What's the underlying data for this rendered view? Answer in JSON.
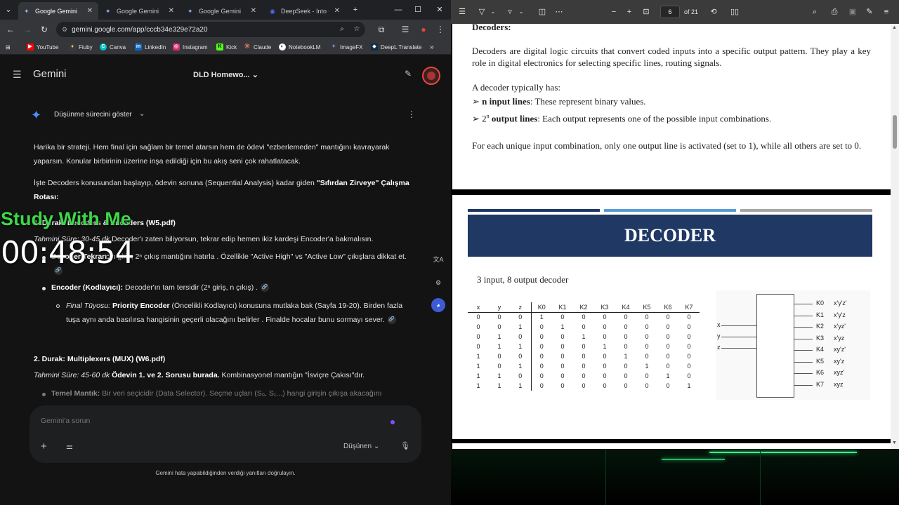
{
  "browser": {
    "tabs": [
      {
        "label": "Google Gemini",
        "active": true
      },
      {
        "label": "Google Gemini",
        "active": false
      },
      {
        "label": "Google Gemini",
        "active": false
      },
      {
        "label": "DeepSeek - Into the",
        "active": false
      }
    ],
    "url": "gemini.google.com/app/cccb34e329e72a20",
    "bookmarks": [
      "YouTube",
      "Fiuby",
      "Canva",
      "LinkedIn",
      "Instagram",
      "Kick",
      "Claude",
      "NotebookLM",
      "ImageFX",
      "DeepL Translate"
    ]
  },
  "gemini": {
    "app_title": "Gemini",
    "chat_title": "DLD Homewo...",
    "show_thinking": "Düşünme sürecini göster",
    "intro": "Harika bir strateji. Hem final için sağlam bir temel atarsın hem de ödevi \"ezberlemeden\" mantığını kavrayarak yaparsın. Konular birbirinin üzerine inşa edildiği için bu akış seni çok rahatlatacak.",
    "route_prefix": "İşte Decoders konusundan başlayıp, ödevin sonuna (Sequential Analysis) kadar giden ",
    "route_bold": "\"Sıfırdan Zirveye\" Çalışma Rotası",
    "route_suffix": ":",
    "step1_title": "1. Durak: Decoders & Encoders (W5.pdf)",
    "step1_time": "Tahmini Süre: 30-45 dk",
    "step1_time_rest": " Decoder'ı zaten biliyorsun, tekrar edip hemen ikiz kardeşi Encoder'a bakmalısın.",
    "step1_b1_bold": "Decoder Tekrarı:",
    "step1_b1_text": " n giriş, 2ⁿ çıkış mantığını hatırla . Özellikle \"Active High\" vs \"Active Low\" çıkışlara dikkat et.",
    "step1_b2_bold": "Encoder (Kodlayıcı):",
    "step1_b2_text": " Decoder'ın tam tersidir (2ⁿ giriş, n çıkış) .",
    "step1_tip_label": "Final Tüyosu:",
    "step1_tip_bold": " Priority Encoder",
    "step1_tip_text": " (Öncelikli Kodlayıcı) konusuna mutlaka bak (Sayfa 19-20). Birden fazla tuşa aynı anda basılırsa hangisinin geçerli olacağını belirler . Finalde hocalar bunu sormayı sever.",
    "step2_title": "2. Durak: Multiplexers (MUX) (W6.pdf)",
    "step2_time": "Tahmini Süre: 45-60 dk",
    "step2_bold": " Ödevin 1. ve 2. Sorusu burada.",
    "step2_text": " Kombinasyonel mantığın \"İsviçre Çakısı\"dır.",
    "step2_b1_bold": "Temel Mantık:",
    "step2_b1_text": " Bir veri seçicidir (Data Selector). Seçme uçları (S₀, S₁...) hangi girişin çıkışa akacağını",
    "prompt_placeholder": "Gemini'a sorun",
    "mode_label": "Düşünen",
    "disclaimer": "Gemini hata yapabildiğinden verdiği yanıtları doğrulayın."
  },
  "overlay": {
    "study_label": "Study With Me",
    "timer": "00:48:54"
  },
  "pdf": {
    "page_number": "6",
    "page_total": "of 21",
    "decoders_heading": "Decoders:",
    "decoders_p1": "Decoders are digital logic circuits that convert coded inputs into a specific output pattern. They play a key role in digital electronics for selecting specific lines, routing signals.",
    "decoders_p2": "A decoder typically has:",
    "item1_bold": "n input lines",
    "item1_text": ": These represent binary values.",
    "item2_pre": "2",
    "item2_sup": "n",
    "item2_bold": " output lines",
    "item2_text": ": Each output represents one of the possible input combinations.",
    "decoders_p3": "For each unique input combination, only one output line is activated (set to 1), while all others are set to 0.",
    "slide_title": "DECODER",
    "slide_subtitle": "3 input, 8 output decoder",
    "table_headers": [
      "x",
      "y",
      "z",
      "K0",
      "K1",
      "K2",
      "K3",
      "K4",
      "K5",
      "K6",
      "K7"
    ],
    "table_rows": [
      [
        "0",
        "0",
        "0",
        "1",
        "0",
        "0",
        "0",
        "0",
        "0",
        "0",
        "0"
      ],
      [
        "0",
        "0",
        "1",
        "0",
        "1",
        "0",
        "0",
        "0",
        "0",
        "0",
        "0"
      ],
      [
        "0",
        "1",
        "0",
        "0",
        "0",
        "1",
        "0",
        "0",
        "0",
        "0",
        "0"
      ],
      [
        "0",
        "1",
        "1",
        "0",
        "0",
        "0",
        "1",
        "0",
        "0",
        "0",
        "0"
      ],
      [
        "1",
        "0",
        "0",
        "0",
        "0",
        "0",
        "0",
        "1",
        "0",
        "0",
        "0"
      ],
      [
        "1",
        "0",
        "1",
        "0",
        "0",
        "0",
        "0",
        "0",
        "1",
        "0",
        "0"
      ],
      [
        "1",
        "1",
        "0",
        "0",
        "0",
        "0",
        "0",
        "0",
        "0",
        "1",
        "0"
      ],
      [
        "1",
        "1",
        "1",
        "0",
        "0",
        "0",
        "0",
        "0",
        "0",
        "0",
        "1"
      ]
    ],
    "diagram_inputs": [
      "x",
      "y",
      "z"
    ],
    "diagram_outputs": [
      {
        "name": "K0",
        "term": "x'y'z'"
      },
      {
        "name": "K1",
        "term": "x'y'z"
      },
      {
        "name": "K2",
        "term": "x'yz'"
      },
      {
        "name": "K3",
        "term": "x'yz"
      },
      {
        "name": "K4",
        "term": "xy'z'"
      },
      {
        "name": "K5",
        "term": "xy'z"
      },
      {
        "name": "K6",
        "term": "xyz'"
      },
      {
        "name": "K7",
        "term": "xyz"
      }
    ],
    "slide_colors": {
      "banner": "#1f3864",
      "bar1": "#1f3864",
      "bar2": "#5b9bd5",
      "bar3": "#a6a6a6"
    }
  }
}
